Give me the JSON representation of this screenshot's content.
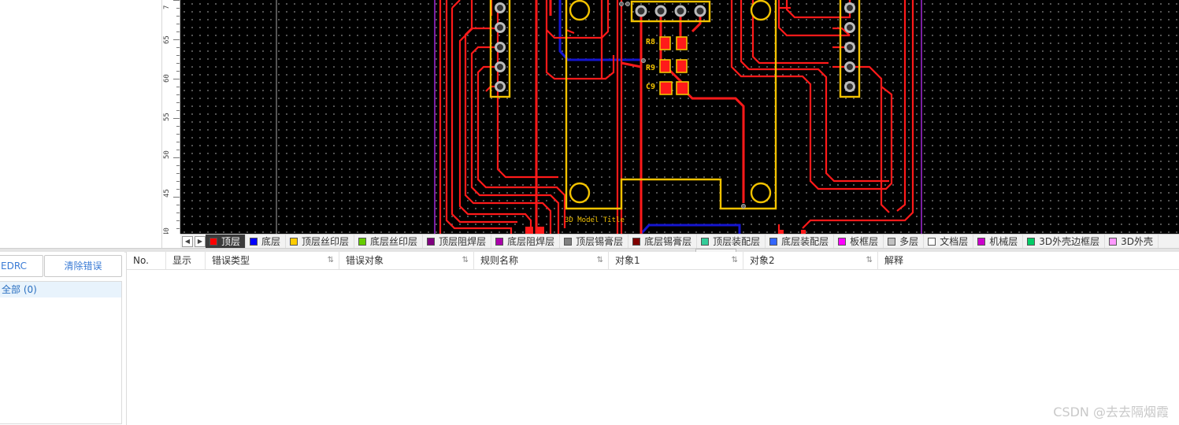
{
  "ruler": {
    "labels": [
      "7",
      "65",
      "60",
      "55",
      "50",
      "45",
      "40"
    ]
  },
  "pcb": {
    "designators": [
      "R8",
      "R9",
      "C9"
    ],
    "model_title": "3D Model Title"
  },
  "layers": {
    "prev_icon": "arrow-left-icon",
    "next_icon": "arrow-right-icon",
    "items": [
      {
        "label": "顶层",
        "color": "#ff0000"
      },
      {
        "label": "底层",
        "color": "#0000ff"
      },
      {
        "label": "顶层丝印层",
        "color": "#ffcc00"
      },
      {
        "label": "底层丝印层",
        "color": "#66cc00"
      },
      {
        "label": "顶层阻焊层",
        "color": "#800080"
      },
      {
        "label": "底层阻焊层",
        "color": "#aa00aa"
      },
      {
        "label": "顶层锡膏层",
        "color": "#808080"
      },
      {
        "label": "底层锡膏层",
        "color": "#800000"
      },
      {
        "label": "顶层装配层",
        "color": "#33cc99"
      },
      {
        "label": "底层装配层",
        "color": "#3366ff"
      },
      {
        "label": "板框层",
        "color": "#ff00ff"
      },
      {
        "label": "多层",
        "color": "#c0c0c0"
      },
      {
        "label": "文档层",
        "color": "#ffffff"
      },
      {
        "label": "机械层",
        "color": "#cc00cc"
      },
      {
        "label": "3D外壳边框层",
        "color": "#00cc66"
      },
      {
        "label": "3D外壳",
        "color": "#ff99ff"
      }
    ]
  },
  "drc": {
    "run_label": "EDRC",
    "clear_label": "清除错误",
    "tree_all": "全部 (0)"
  },
  "table": {
    "columns": [
      "No.",
      "显示",
      "错误类型",
      "错误对象",
      "规则名称",
      "对象1",
      "对象2",
      "解释"
    ]
  },
  "watermark": "CSDN @去去隔烟霞"
}
